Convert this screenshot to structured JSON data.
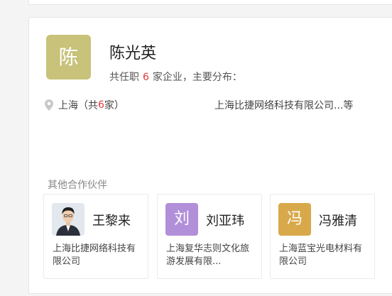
{
  "person": {
    "avatar_char": "陈",
    "avatar_color": "#c8c27a",
    "name": "陈光英",
    "summary_prefix": "共任职",
    "company_count": "6",
    "summary_suffix": "家企业，主要分布："
  },
  "location": {
    "icon": "map-pin-icon",
    "city": "上海（共",
    "count": "6",
    "suffix": "家）",
    "companies": "上海比捷网络科技有限公司...等"
  },
  "partners_section": {
    "title": "其他合作伙伴",
    "items": [
      {
        "avatar_char": "",
        "avatar_type": "photo",
        "name": "王黎来",
        "company": "上海比捷网络科技有限公司"
      },
      {
        "avatar_char": "刘",
        "avatar_color": "#b18fd9",
        "name": "刘亚玮",
        "company": "上海复华志则文化旅游发展有限..."
      },
      {
        "avatar_char": "冯",
        "avatar_color": "#d8a94a",
        "name": "冯雅清",
        "company": "上海蓝宝光电材料有限公司"
      }
    ]
  }
}
